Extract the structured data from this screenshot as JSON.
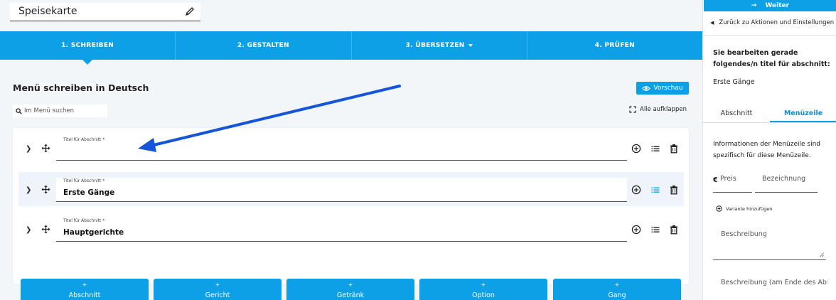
{
  "menu_title": "Speisekarte",
  "tabs": [
    {
      "label": "1. SCHREIBEN",
      "active": true
    },
    {
      "label": "2. GESTALTEN",
      "active": false
    },
    {
      "label": "3. ÜBERSETZEN",
      "active": false,
      "dropdown": true
    },
    {
      "label": "4. PRÜFEN",
      "active": false
    }
  ],
  "main": {
    "heading": "Menü schreiben in Deutsch",
    "preview_label": "Vorschau",
    "search_placeholder": "Im Menü suchen",
    "expand_all_label": "Alle aufklappen",
    "sections": [
      {
        "label": "Titel für Abschnitt *",
        "value": "",
        "selected": false
      },
      {
        "label": "Titel für Abschnitt *",
        "value": "Erste Gänge",
        "selected": true
      },
      {
        "label": "Titel für Abschnitt *",
        "value": "Hauptgerichte",
        "selected": false
      }
    ],
    "add_buttons": [
      {
        "plus": "+",
        "label": "Abschnitt"
      },
      {
        "plus": "+",
        "label": "Gericht"
      },
      {
        "plus": "+",
        "label": "Getränk"
      },
      {
        "plus": "+",
        "label": "Option"
      },
      {
        "plus": "+",
        "label": "Gang"
      }
    ]
  },
  "sidebar": {
    "next_label": "Weiter",
    "back_label": "Zurück zu Aktionen und Einstellungen",
    "editing_text": "Sie bearbeiten gerade folgendes/n titel für abschnitt:",
    "section_name": "Erste Gänge",
    "tabs": [
      {
        "label": "Abschnitt",
        "active": false
      },
      {
        "label": "Menüzeile",
        "active": true
      }
    ],
    "info_text": "Informationen der Menüzeile sind spezifisch für diese Menüzeile.",
    "currency_symbol": "€",
    "price_placeholder": "Preis",
    "name_placeholder": "Bezeichnung",
    "add_variant_label": "Variante hinzufügen",
    "description_placeholder": "Beschreibung",
    "description_end_placeholder": "Beschreibung (am Ende des Abschnitts)"
  },
  "colors": {
    "accent": "#0ea0e6",
    "annotation_arrow": "#1455d9"
  }
}
